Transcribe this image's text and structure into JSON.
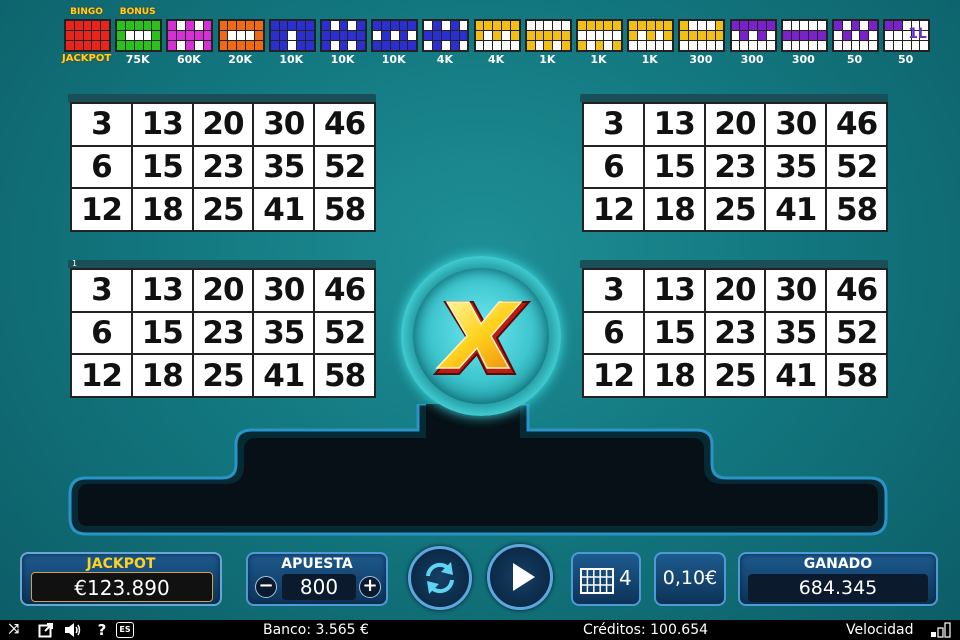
{
  "paytable": [
    {
      "top_label": "BINGO",
      "prize": "JACKPOT",
      "prize_gold": true,
      "color": "#e8241d",
      "pattern": [
        1,
        1,
        1,
        1,
        1,
        1,
        1,
        1,
        1,
        1,
        1,
        1,
        1,
        1,
        1
      ]
    },
    {
      "top_label": "BONUS",
      "prize": "75K",
      "prize_gold": false,
      "color": "#2bc11b",
      "pattern": [
        1,
        1,
        1,
        1,
        1,
        1,
        0,
        0,
        0,
        1,
        1,
        1,
        1,
        1,
        1
      ]
    },
    {
      "top_label": "",
      "prize": "60K",
      "prize_gold": false,
      "color": "#d62fd6",
      "pattern": [
        1,
        0,
        1,
        0,
        1,
        1,
        1,
        1,
        1,
        1,
        1,
        0,
        1,
        0,
        1
      ]
    },
    {
      "top_label": "",
      "prize": "20K",
      "prize_gold": false,
      "color": "#ee6a14",
      "pattern": [
        1,
        1,
        1,
        1,
        1,
        1,
        0,
        0,
        0,
        1,
        1,
        1,
        1,
        1,
        1
      ]
    },
    {
      "top_label": "",
      "prize": "10K",
      "prize_gold": false,
      "color": "#2b2fd0",
      "pattern": [
        1,
        1,
        1,
        1,
        1,
        1,
        1,
        0,
        1,
        1,
        1,
        1,
        0,
        1,
        1
      ]
    },
    {
      "top_label": "",
      "prize": "10K",
      "prize_gold": false,
      "color": "#2b2fd0",
      "pattern": [
        1,
        0,
        1,
        0,
        1,
        1,
        1,
        1,
        1,
        1,
        1,
        0,
        1,
        0,
        1
      ]
    },
    {
      "top_label": "",
      "prize": "10K",
      "prize_gold": false,
      "color": "#2b2fd0",
      "pattern": [
        1,
        1,
        1,
        1,
        1,
        0,
        1,
        0,
        1,
        0,
        1,
        1,
        1,
        1,
        1
      ]
    },
    {
      "top_label": "",
      "prize": "4K",
      "prize_gold": false,
      "color": "#2b2fd0",
      "pattern": [
        0,
        1,
        0,
        1,
        0,
        1,
        1,
        1,
        1,
        1,
        0,
        1,
        0,
        1,
        0
      ]
    },
    {
      "top_label": "",
      "prize": "4K",
      "prize_gold": false,
      "color": "#f2bf16",
      "pattern": [
        1,
        1,
        1,
        1,
        1,
        1,
        0,
        1,
        0,
        1,
        0,
        0,
        0,
        0,
        0
      ]
    },
    {
      "top_label": "",
      "prize": "1K",
      "prize_gold": false,
      "color": "#f2bf16",
      "pattern": [
        0,
        0,
        0,
        0,
        0,
        1,
        1,
        1,
        1,
        1,
        1,
        0,
        1,
        0,
        1
      ]
    },
    {
      "top_label": "",
      "prize": "1K",
      "prize_gold": false,
      "color": "#f2bf16",
      "pattern": [
        1,
        1,
        1,
        1,
        1,
        0,
        0,
        0,
        0,
        0,
        1,
        0,
        1,
        0,
        1
      ]
    },
    {
      "top_label": "",
      "prize": "1K",
      "prize_gold": false,
      "color": "#f2bf16",
      "pattern": [
        1,
        1,
        1,
        1,
        1,
        1,
        0,
        1,
        0,
        1,
        0,
        0,
        0,
        0,
        0
      ]
    },
    {
      "top_label": "",
      "prize": "300",
      "prize_gold": false,
      "color": "#f2bf16",
      "pattern": [
        1,
        0,
        0,
        0,
        1,
        1,
        1,
        1,
        1,
        1,
        0,
        0,
        0,
        0,
        0
      ]
    },
    {
      "top_label": "",
      "prize": "300",
      "prize_gold": false,
      "color": "#7a22c9",
      "pattern": [
        1,
        1,
        1,
        1,
        1,
        0,
        1,
        0,
        1,
        0,
        0,
        0,
        0,
        0,
        0
      ]
    },
    {
      "top_label": "",
      "prize": "300",
      "prize_gold": false,
      "color": "#7a22c9",
      "pattern": [
        0,
        0,
        0,
        0,
        0,
        1,
        1,
        1,
        1,
        1,
        0,
        0,
        0,
        0,
        0
      ]
    },
    {
      "top_label": "",
      "prize": "50",
      "prize_gold": false,
      "color": "#7a22c9",
      "pattern": [
        1,
        0,
        1,
        0,
        1,
        0,
        1,
        0,
        1,
        0,
        0,
        0,
        0,
        0,
        0
      ]
    },
    {
      "top_label": "",
      "prize": "50",
      "prize_gold": false,
      "color": "#7a22c9",
      "pattern": [
        1,
        1,
        0,
        0,
        0,
        0,
        0,
        0,
        0,
        0,
        0,
        0,
        0,
        0,
        0
      ],
      "badge": "1L"
    }
  ],
  "cards": [
    {
      "id": "card-top-left",
      "tab_label": "",
      "numbers": [
        "3",
        "13",
        "20",
        "30",
        "46",
        "6",
        "15",
        "23",
        "35",
        "52",
        "12",
        "18",
        "25",
        "41",
        "58"
      ]
    },
    {
      "id": "card-top-right",
      "tab_label": "",
      "numbers": [
        "3",
        "13",
        "20",
        "30",
        "46",
        "6",
        "15",
        "23",
        "35",
        "52",
        "12",
        "18",
        "25",
        "41",
        "58"
      ]
    },
    {
      "id": "card-bottom-left",
      "tab_label": "1",
      "numbers": [
        "3",
        "13",
        "20",
        "30",
        "46",
        "6",
        "15",
        "23",
        "35",
        "52",
        "12",
        "18",
        "25",
        "41",
        "58"
      ]
    },
    {
      "id": "card-bottom-right",
      "tab_label": "",
      "numbers": [
        "3",
        "13",
        "20",
        "30",
        "46",
        "6",
        "15",
        "23",
        "35",
        "52",
        "12",
        "18",
        "25",
        "41",
        "58"
      ]
    }
  ],
  "controls": {
    "jackpot_label": "JACKPOT",
    "jackpot_value": "€123.890",
    "apuesta_label": "APUESTA",
    "apuesta_value": "800",
    "minus_label": "−",
    "plus_label": "+",
    "cards_count": "4",
    "coin_value": "0,10€",
    "ganado_label": "GANADO",
    "ganado_value": "684.345"
  },
  "status_bar": {
    "lang": "ES",
    "banco": "Banco: 3.565 €",
    "creditos": "Créditos: 100.654",
    "velocidad": "Velocidad"
  },
  "colors": {
    "background": "#137880",
    "panel": "#1d5b8f",
    "panel_border": "#4f9ad6",
    "gold": "#ffd21e"
  }
}
